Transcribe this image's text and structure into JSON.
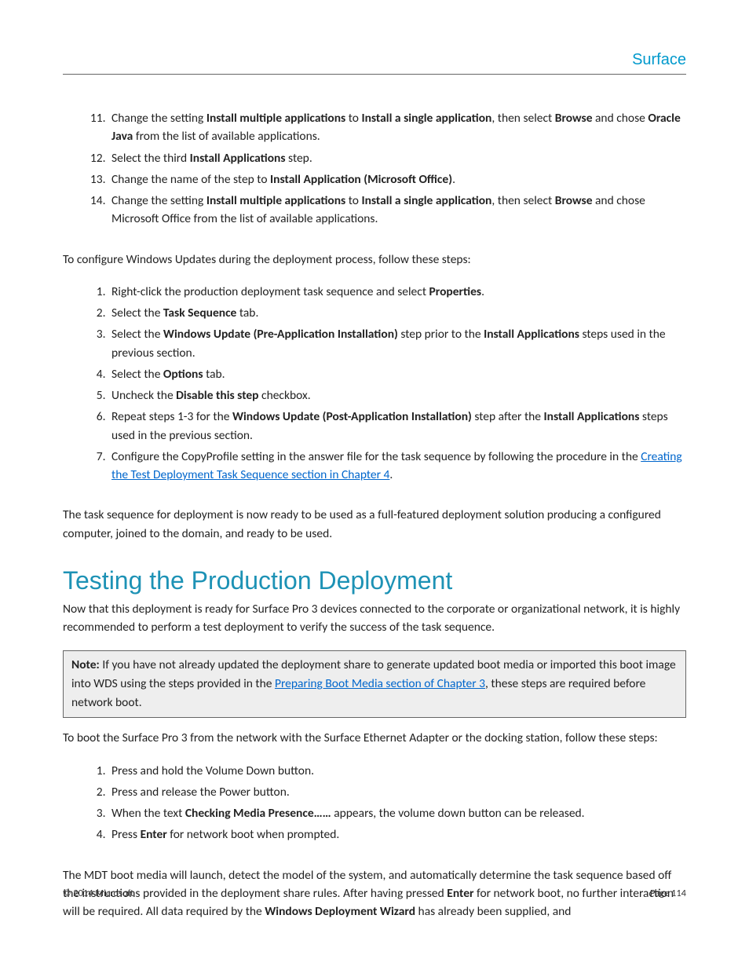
{
  "brand": "Surface",
  "list1": {
    "start": 11,
    "items": [
      {
        "html": "Change the setting <b>Install multiple applications</b> to <b>Install a single application</b>, then select <b>Browse</b> and chose <b>Oracle Java</b> from the list of available applications."
      },
      {
        "html": "Select the third <b>Install Applications</b> step."
      },
      {
        "html": "Change the name of the step to <b>Install Application (Microsoft Office)</b>."
      },
      {
        "html": "Change the setting <b>Install multiple applications</b> to <b>Install a single application</b>, then select <b>Browse</b> and chose Microsoft Office from the list of available applications."
      }
    ]
  },
  "para1": "To configure Windows Updates during the deployment process, follow these steps:",
  "list2": {
    "start": 1,
    "items": [
      {
        "html": "Right-click the production deployment task sequence and select <b>Properties</b>."
      },
      {
        "html": "Select the <b>Task Sequence</b> tab."
      },
      {
        "html": "Select the <b>Windows Update (Pre-Application Installation)</b> step prior to the <b>Install Applications</b> steps used in the previous section."
      },
      {
        "html": "Select the <b>Options</b> tab."
      },
      {
        "html": "Uncheck the <b>Disable this step</b> checkbox."
      },
      {
        "html": "Repeat steps 1-3 for the <b>Windows Update (Post-Application Installation)</b> step after the <b>Install Applications</b> steps used in the previous section."
      },
      {
        "html": "Configure the CopyProfile setting in the answer file for the task sequence by following the procedure in the <a class=\"ilink\" data-name=\"link-creating-test-deployment\" data-interactable=\"true\">Creating the Test Deployment Task Sequence section in Chapter 4</a>."
      }
    ]
  },
  "para2": "The task sequence for deployment is now ready to be used as a full-featured deployment solution producing a configured computer, joined to the domain, and ready to be used.",
  "heading": "Testing the Production Deployment",
  "para3": "Now that this deployment is ready for Surface Pro 3 devices connected to the corporate or organizational network, it is highly recommended to perform a test deployment to verify the success of the task sequence.",
  "note_html": "<b>Note:</b> If you have not already updated the deployment share to generate updated boot media or imported this boot image into WDS using the steps provided in the <a class=\"ilink\" data-name=\"link-preparing-boot-media\" data-interactable=\"true\">Preparing Boot Media section of Chapter 3</a>, these steps are required before network boot.",
  "para4": "To boot the Surface Pro 3 from the network with the Surface Ethernet Adapter or the docking station, follow these steps:",
  "list3": {
    "start": 1,
    "items": [
      {
        "html": "Press and hold the Volume Down button."
      },
      {
        "html": "Press and release the Power button."
      },
      {
        "html": "When the text <b>Checking Media Presence……</b> appears, the volume down button can be released."
      },
      {
        "html": "Press <b>Enter</b> for network boot when prompted."
      }
    ]
  },
  "para5_html": "The MDT boot media will launch, detect the model of the system, and automatically determine the task sequence based off the instructions provided in the deployment share rules. After having pressed <b>Enter</b> for network boot, no further interaction will be required. All data required by the <b>Windows Deployment Wizard</b> has already been supplied, and",
  "footer": {
    "copyright": "© 2014 Microsoft",
    "page": "Page 114"
  }
}
